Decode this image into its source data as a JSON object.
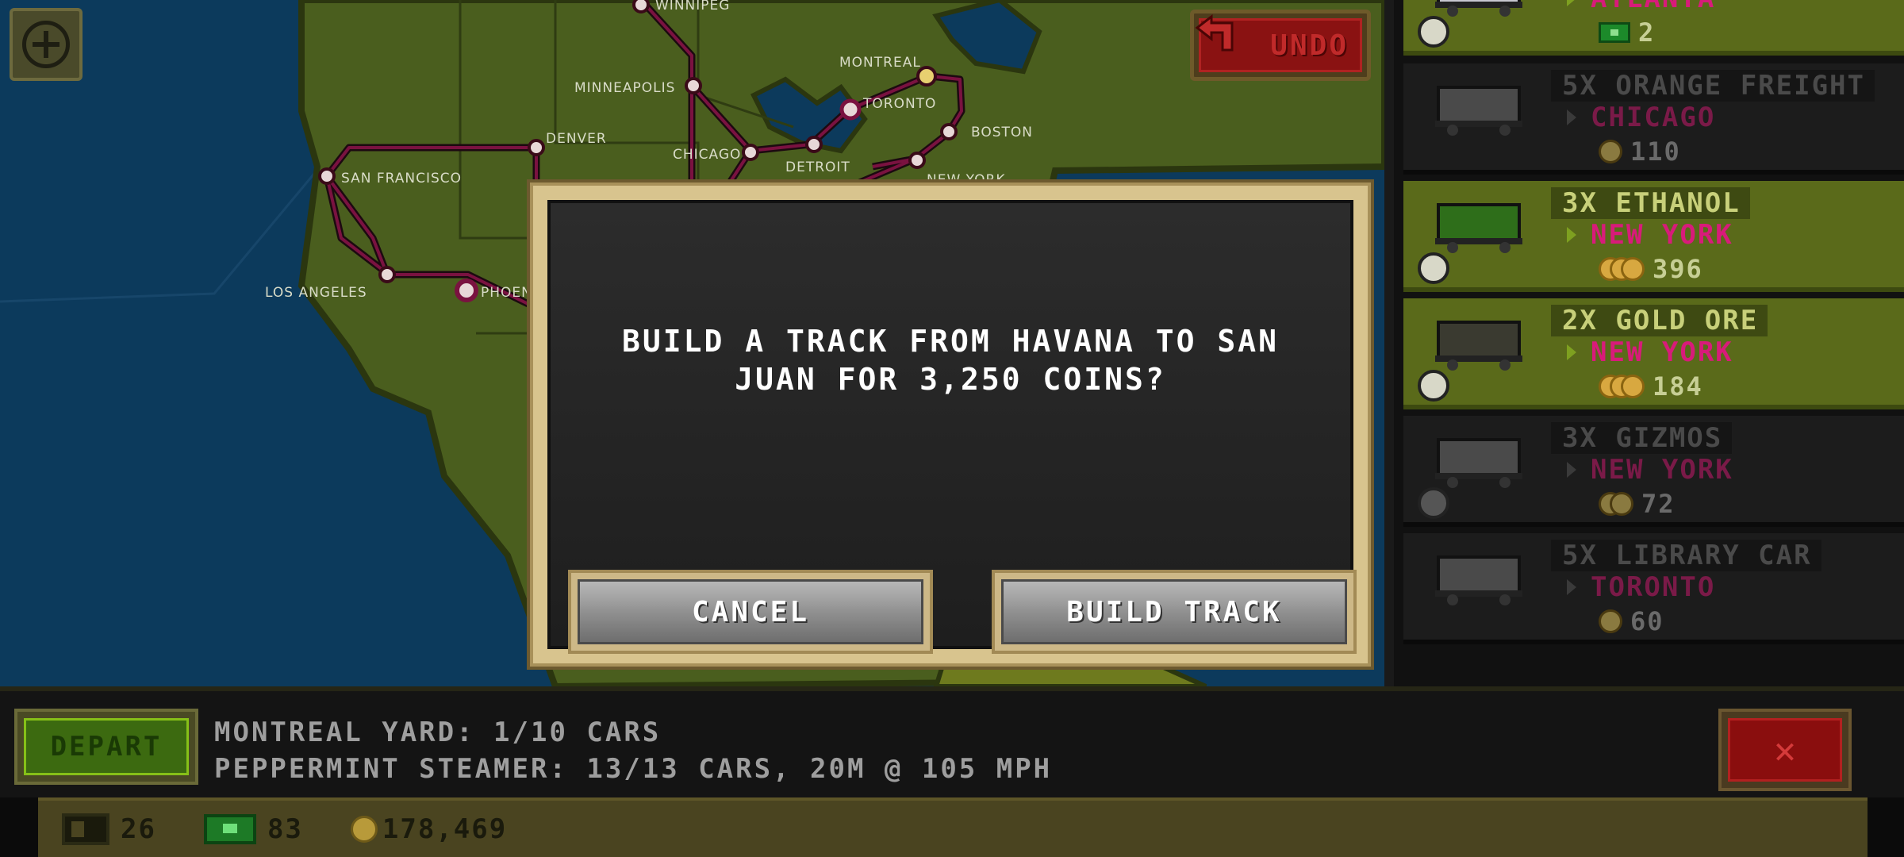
{
  "map": {
    "add_button_icon": "plus-circle-icon",
    "undo_label": "UNDO",
    "undo_icon": "undo-arrow-icon",
    "cities": [
      {
        "name": "WINNIPEG"
      },
      {
        "name": "MONTREAL"
      },
      {
        "name": "MINNEAPOLIS"
      },
      {
        "name": "TORONTO"
      },
      {
        "name": "DENVER"
      },
      {
        "name": "CHICAGO"
      },
      {
        "name": "BOSTON"
      },
      {
        "name": "DETROIT"
      },
      {
        "name": "SAN FRANCISCO"
      },
      {
        "name": "NEW YORK"
      },
      {
        "name": "LOS ANGELES"
      },
      {
        "name": "PHOENIX"
      }
    ]
  },
  "cargo": [
    {
      "title": "",
      "destination": "ATLANTA",
      "reward": "2",
      "reward_type": "money",
      "active": true
    },
    {
      "title": "5X ORANGE FREIGHT",
      "destination": "CHICAGO",
      "reward": "110",
      "reward_type": "coins",
      "coin_count": 1,
      "active": false
    },
    {
      "title": "3X ETHANOL",
      "destination": "NEW YORK",
      "reward": "396",
      "reward_type": "coins",
      "coin_count": 3,
      "active": true
    },
    {
      "title": "2X GOLD ORE",
      "destination": "NEW YORK",
      "reward": "184",
      "reward_type": "coins",
      "coin_count": 3,
      "active": true
    },
    {
      "title": "3X GIZMOS",
      "destination": "NEW YORK",
      "reward": "72",
      "reward_type": "coins",
      "coin_count": 2,
      "active": false
    },
    {
      "title": "5X LIBRARY CAR",
      "destination": "TORONTO",
      "reward": "60",
      "reward_type": "coins",
      "coin_count": 1,
      "active": false
    }
  ],
  "dialog": {
    "message_line1": "BUILD A TRACK FROM HAVANA TO SAN",
    "message_line2": "JUAN FOR 3,250 COINS?",
    "cancel_label": "CANCEL",
    "build_label": "BUILD TRACK"
  },
  "status": {
    "depart_label": "DEPART",
    "line1": "MONTREAL YARD: 1/10 CARS",
    "line2": "PEPPERMINT STEAMER: 13/13 CARS, 20M @ 105 MPH",
    "close_label": "✕"
  },
  "resources": {
    "cars": "26",
    "money": "83",
    "coins": "178,469"
  },
  "colors": {
    "ocean": "#0c3a5c",
    "land": "#4a5e1e",
    "track": "#5a0e2e",
    "active_cargo": "#5a6a1a",
    "destination": "#d81b7a",
    "dialog_border": "#d8c48e"
  }
}
